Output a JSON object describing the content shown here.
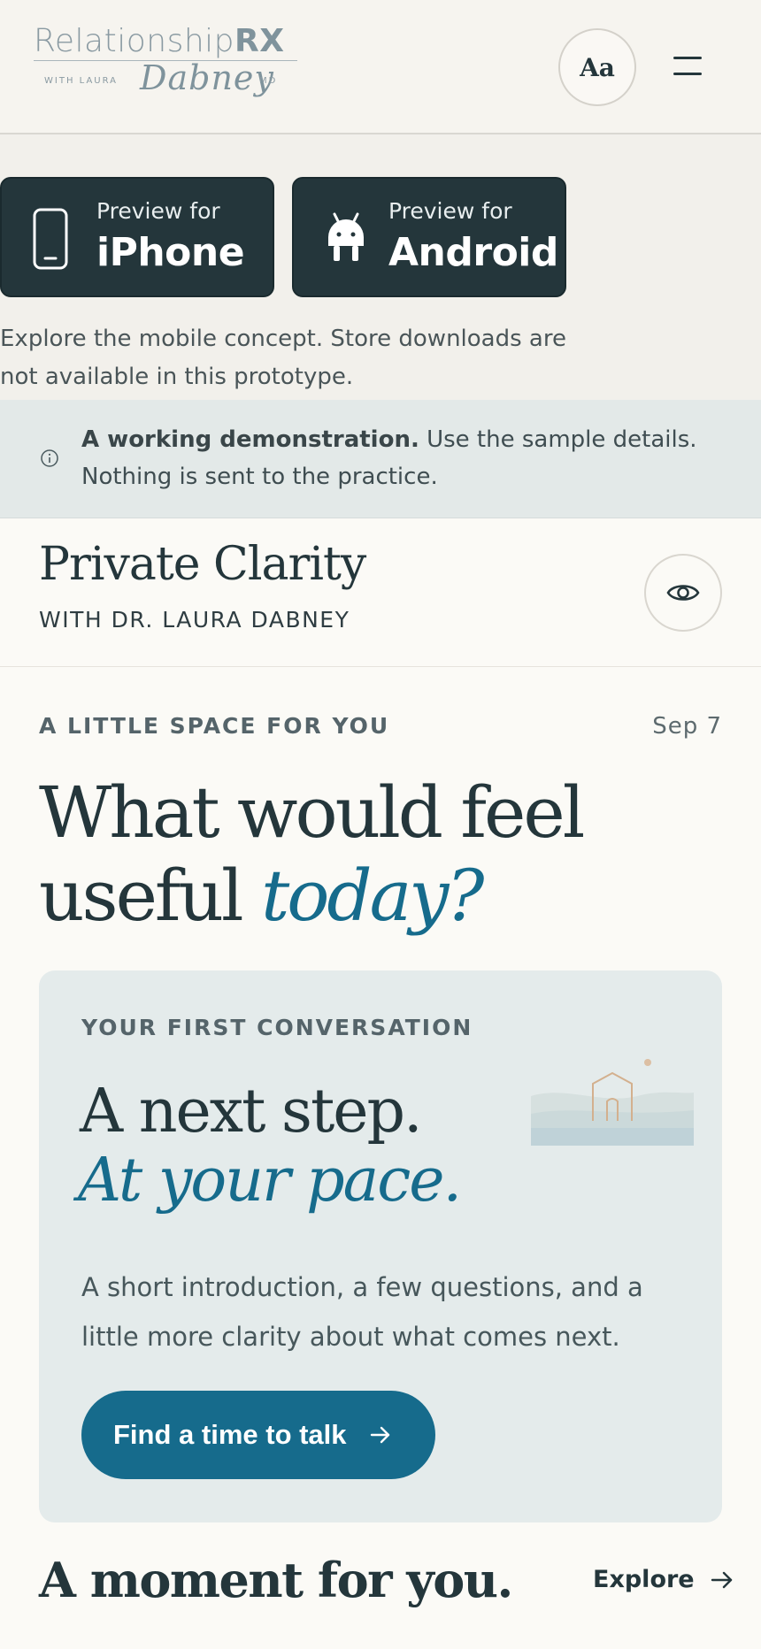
{
  "header": {
    "logo": {
      "main_light": "Relationship",
      "main_bold": "RX",
      "with": "WITH LAURA",
      "signature": "Dabney",
      "suffix": "MD"
    },
    "text_size_button": "Aa",
    "menu_icon": "hamburger-menu-icon"
  },
  "store_preview": {
    "iphone": {
      "small": "Preview for",
      "big": "iPhone",
      "icon": "phone-icon"
    },
    "android": {
      "small": "Preview for",
      "big": "Android",
      "icon": "android-icon"
    },
    "note": "Explore the mobile concept. Store downloads are not available in this prototype."
  },
  "demo_banner": {
    "icon": "info-icon",
    "bold": "A working demonstration.",
    "text": " Use the sample details. Nothing is sent to the practice."
  },
  "practice": {
    "title": "Private Clarity",
    "subtitle": "WITH DR. LAURA DABNEY",
    "visibility_icon": "eye-icon"
  },
  "main": {
    "eyebrow": "A LITTLE SPACE FOR YOU",
    "date": "Sep 7",
    "headline_plain": "What would feel useful ",
    "headline_accent": "today?",
    "card": {
      "label": "YOUR FIRST CONVERSATION",
      "title_line1": "A next step.",
      "title_line2": "At your pace.",
      "description": "A short introduction, a few questions, and a little more clarity about what comes next.",
      "cta": "Find a time to talk"
    },
    "moment_title": "A moment for you.",
    "explore": "Explore"
  },
  "colors": {
    "dark": "#24363b",
    "accent": "#166b8c",
    "card_bg": "#e4ebeb",
    "banner_bg": "#e3e9e8",
    "page_bg": "#fbfaf6"
  }
}
